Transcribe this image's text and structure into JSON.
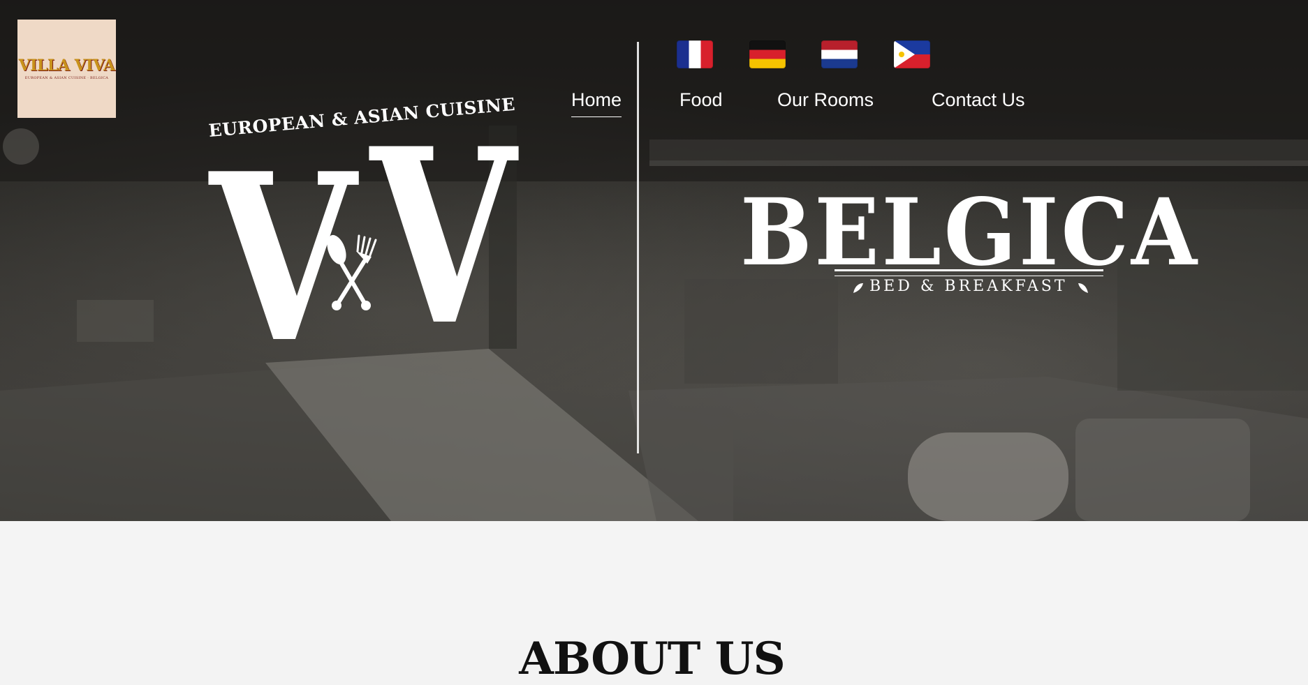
{
  "header": {
    "logo": {
      "text": "VILLA VIVA",
      "subtext": "EUROPEAN & ASIAN CUISINE · BELGICA",
      "colors": {
        "background": "#efd9c6",
        "primary": "#c8921c",
        "accent": "#7a1a14"
      }
    },
    "languages": [
      {
        "name": "French",
        "icon": "flag-france-icon"
      },
      {
        "name": "German",
        "icon": "flag-germany-icon"
      },
      {
        "name": "Dutch",
        "icon": "flag-netherlands-icon"
      },
      {
        "name": "Filipino",
        "icon": "flag-philippines-icon"
      }
    ],
    "nav": [
      {
        "label": "Home",
        "active": true
      },
      {
        "label": "Food",
        "active": false
      },
      {
        "label": "Our Rooms",
        "active": false
      },
      {
        "label": "Contact Us",
        "active": false
      }
    ]
  },
  "hero": {
    "restaurant": {
      "tagline": "EUROPEAN & ASIAN CUISINE",
      "monogram_left": "V",
      "monogram_right": "V",
      "icon": "spoon-fork-icon"
    },
    "bnb": {
      "name": "BELGICA",
      "subtitle": "BED & BREAKFAST",
      "icon": "leaf-icon"
    }
  },
  "about": {
    "title": "ABOUT US"
  }
}
